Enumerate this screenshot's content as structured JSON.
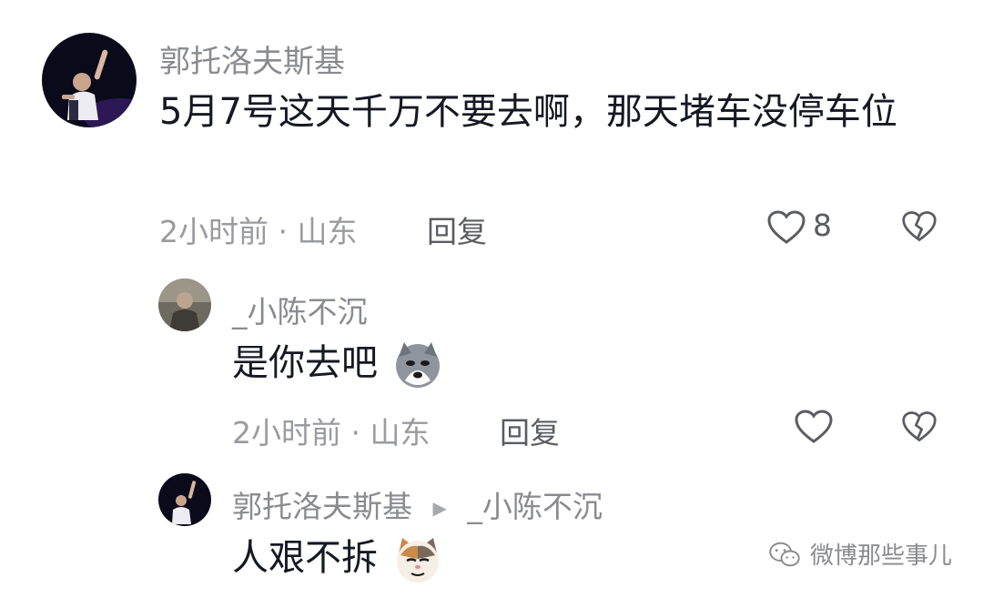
{
  "comments": [
    {
      "username": "郭托洛夫斯基",
      "text": "5月7号这天千万不要去啊，那天堵车没停车位",
      "meta": "2小时前 · 山东",
      "reply_label": "回复",
      "like_count": "8"
    }
  ],
  "replies": [
    {
      "username": "_小陈不沉",
      "text": "是你去吧",
      "emoji": "husky-dog-emoji",
      "meta": "2小时前 · 山东",
      "reply_label": "回复"
    },
    {
      "username": "郭托洛夫斯基",
      "reply_to": "_小陈不沉",
      "text": "人艰不拆",
      "emoji": "cat-face-emoji"
    }
  ],
  "watermark": "微博那些事儿",
  "colors": {
    "text": "#161823",
    "username": "#8a8b91",
    "meta": "#9a9ba0",
    "icon": "#5b5c63"
  }
}
